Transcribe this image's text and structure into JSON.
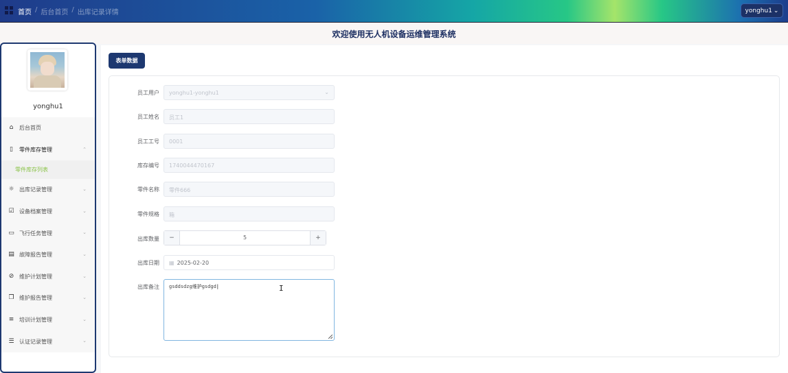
{
  "topbar": {
    "breadcrumbs": [
      "首页",
      "后台首页",
      "出库记录详情"
    ],
    "user_button": "yonghu1"
  },
  "header": {
    "title": "欢迎使用无人机设备运维管理系统"
  },
  "sidebar": {
    "username": "yonghu1",
    "items": [
      {
        "label": "后台首页",
        "icon": "home-icon",
        "chevron": ""
      },
      {
        "label": "零件库存管理",
        "icon": "bookmark-icon",
        "chevron": "^"
      },
      {
        "label": "出库记录管理",
        "icon": "sun-icon",
        "chevron": "v"
      },
      {
        "label": "设备档案管理",
        "icon": "checkbox-icon",
        "chevron": "v"
      },
      {
        "label": "飞行任务管理",
        "icon": "chat-icon",
        "chevron": "v"
      },
      {
        "label": "故障报告管理",
        "icon": "archive-icon",
        "chevron": "v"
      },
      {
        "label": "维护计划管理",
        "icon": "paperclip-icon",
        "chevron": "v"
      },
      {
        "label": "维护报告管理",
        "icon": "copy-icon",
        "chevron": "v"
      },
      {
        "label": "培训计划管理",
        "icon": "sliders-icon",
        "chevron": "v"
      },
      {
        "label": "认证记录管理",
        "icon": "list-icon",
        "chevron": "v"
      }
    ],
    "submenu_label": "零件库存列表"
  },
  "main": {
    "tab_label": "表单数据",
    "form": {
      "employee_user": {
        "label": "员工用户",
        "value": "yonghu1-yonghu1"
      },
      "employee_name": {
        "label": "员工姓名",
        "value": "员工1"
      },
      "employee_id": {
        "label": "员工工号",
        "value": "0001"
      },
      "stock_no": {
        "label": "库存编号",
        "value": "1740044470167"
      },
      "part_name": {
        "label": "零件名称",
        "value": "零件666"
      },
      "part_spec": {
        "label": "零件规格",
        "value": "箱"
      },
      "quantity": {
        "label": "出库数量",
        "value": "5",
        "minus": "−",
        "plus": "+"
      },
      "date": {
        "label": "出库日期",
        "value": "2025-02-20"
      },
      "remark": {
        "label": "出库备注",
        "value": "gsddsdzg维护gsdgd"
      }
    }
  },
  "colors": {
    "accent": "#1d3870",
    "submenu_active": "#8bc34a"
  }
}
